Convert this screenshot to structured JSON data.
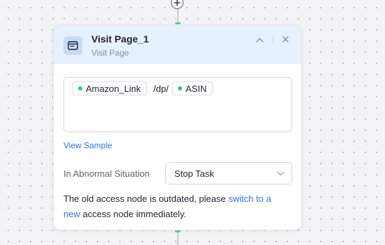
{
  "node": {
    "title": "Visit Page_1",
    "subtitle": "Visit Page",
    "icon": "browser-window-icon",
    "controls": {
      "collapse_icon": "chevron-up-icon",
      "close_icon": "close-icon"
    }
  },
  "url_field": {
    "chip_1": "Amazon_Link",
    "literal": "/dp/",
    "chip_2": "ASIN",
    "chip_dot_color": "#2ecc71"
  },
  "view_sample": "View Sample",
  "abnormal": {
    "label": "In Abnormal Situation",
    "value": "Stop Task"
  },
  "notice": {
    "part_1": "The old access node is outdated, please",
    "link_1": "switch to a",
    "link_2": "new",
    "part_2": "access node immediately."
  },
  "canvas": {
    "add_icon": "plus-icon",
    "port_color": "#3ddc84",
    "accent_color": "#2f74e6",
    "header_color": "#e6f0fe"
  }
}
